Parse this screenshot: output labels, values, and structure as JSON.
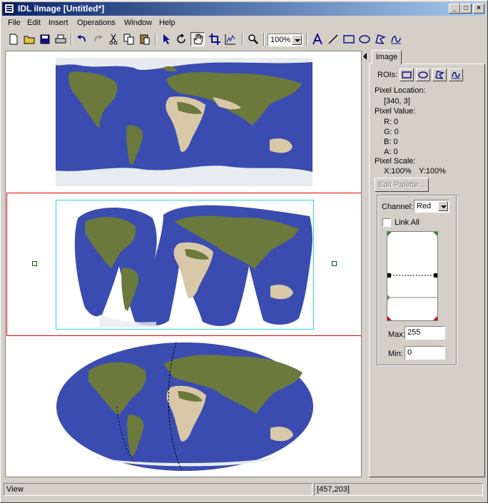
{
  "window": {
    "title": "IDL iImage [Untitled*]"
  },
  "menu": [
    "File",
    "Edit",
    "Insert",
    "Operations",
    "Window",
    "Help"
  ],
  "toolbar": {
    "zoom": "100%"
  },
  "side_panel": {
    "tab": "Image",
    "rois_label": "ROIs:",
    "pixel_location_label": "Pixel Location:",
    "pixel_location_value": "[340, 3]",
    "pixel_value_label": "Pixel Value:",
    "r": "R: 0",
    "g": "G: 0",
    "b": "B: 0",
    "a": "A: 0",
    "pixel_scale_label": "Pixel Scale:",
    "pixel_scale_x": "X:100%",
    "pixel_scale_y": "Y:100%",
    "edit_palette": "Edit Palette...",
    "channel_label": "Channel:",
    "channel_value": "Red",
    "link_all": "Link All",
    "max_label": "Max:",
    "max_value": "255",
    "min_label": "Min:",
    "min_value": "0"
  },
  "status": {
    "left": "View",
    "right": "[457,203]"
  },
  "colors": {
    "ocean": "#3a4cb0",
    "land": "#6b7a3c",
    "desert": "#d8c8a8",
    "ice": "#e8ecf0",
    "selection": "#e00000",
    "bbox": "#2ad4e0"
  }
}
